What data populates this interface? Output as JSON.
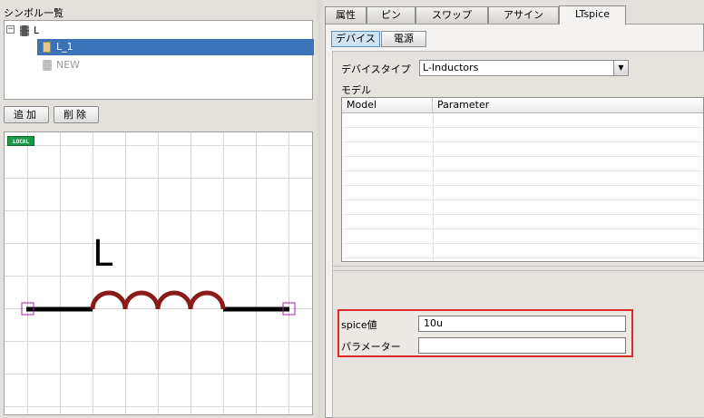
{
  "symbol_list": {
    "title": "シンボル一覧",
    "tree_toggle": "−",
    "root": "L",
    "selected_item": "L_1",
    "new_item": "NEW"
  },
  "buttons": {
    "add": "追加",
    "delete": "削除"
  },
  "canvas": {
    "badge": "LOCAL",
    "symbol_letter": "L"
  },
  "tabs": [
    {
      "label": "属性"
    },
    {
      "label": "ピン"
    },
    {
      "label": "スワップ"
    },
    {
      "label": "アサイン"
    },
    {
      "label": "LTspice"
    }
  ],
  "active_tab": "LTspice",
  "subtabs": [
    {
      "label": "デバイス"
    },
    {
      "label": "電源"
    }
  ],
  "device": {
    "type_label": "デバイスタイプ",
    "type_value": "L-Inductors",
    "model_label": "モデル",
    "columns": [
      "Model",
      "Parameter"
    ]
  },
  "spice": {
    "value_label": "spice値",
    "value": "10u",
    "param_label": "パラメーター",
    "param_value": ""
  },
  "colors": {
    "selection": "#3b73b9",
    "highlight_box": "#e02a2a",
    "inductor_coil": "#8b1a1a",
    "pin_marker": "#a020a0"
  }
}
